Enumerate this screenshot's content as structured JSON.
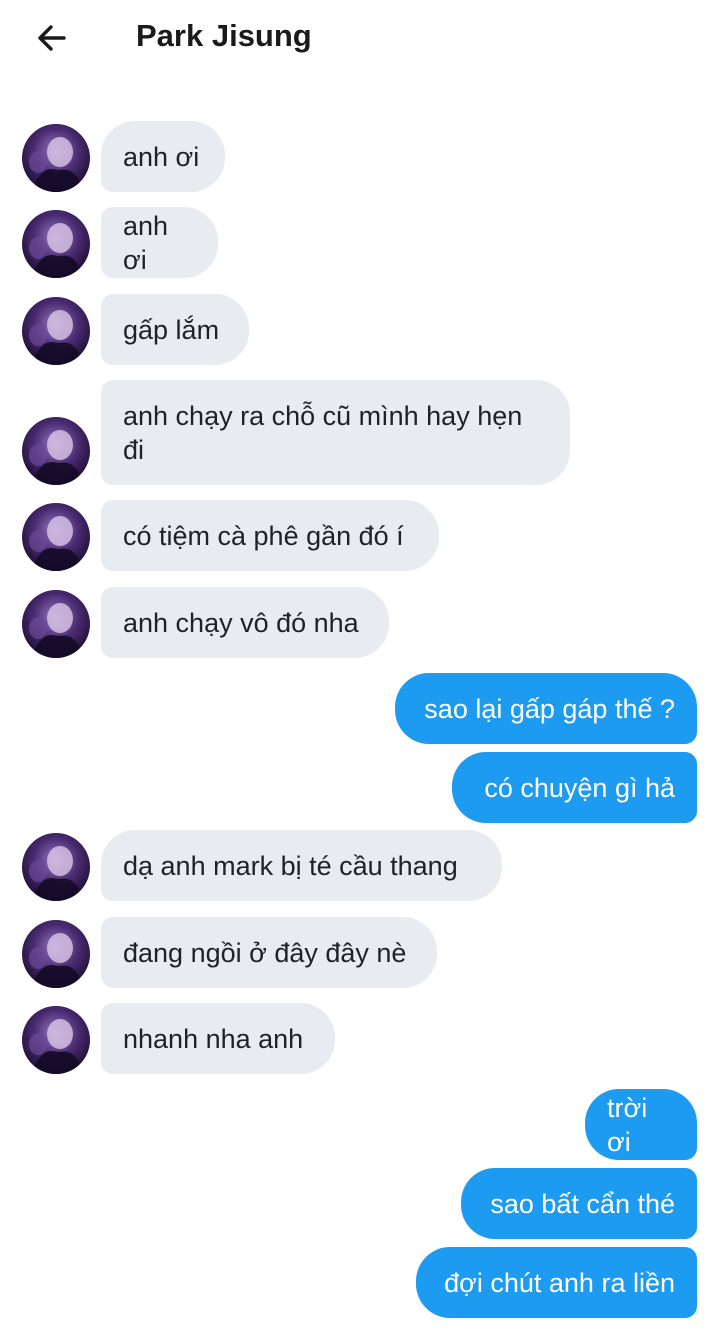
{
  "header": {
    "title": "Park Jisung",
    "back_icon": "arrow-left-icon"
  },
  "colors": {
    "incoming_bubble": "#e8ebef",
    "outgoing_bubble": "#1d9bf0",
    "avatar_tone": "#3a1f5c"
  },
  "messages": [
    {
      "side": "in",
      "text": "anh ơi"
    },
    {
      "side": "in",
      "text": "anh ơi"
    },
    {
      "side": "in",
      "text": "gấp lắm"
    },
    {
      "side": "in",
      "text": "anh chạy ra chỗ cũ mình hay hẹn đi"
    },
    {
      "side": "in",
      "text": "có tiệm cà phê gần đó í"
    },
    {
      "side": "in",
      "text": "anh chạy vô đó nha"
    },
    {
      "side": "out",
      "text": "sao lại gấp gáp thế ?"
    },
    {
      "side": "out",
      "text": "có chuyện gì hả"
    },
    {
      "side": "in",
      "text": "dạ anh mark bị té cầu thang"
    },
    {
      "side": "in",
      "text": "đang ngồi ở đây đây nè"
    },
    {
      "side": "in",
      "text": "nhanh nha anh"
    },
    {
      "side": "out",
      "text": "trời ơi"
    },
    {
      "side": "out",
      "text": "sao bất cẩn thé"
    },
    {
      "side": "out",
      "text": "đợi chút anh ra liền"
    }
  ]
}
